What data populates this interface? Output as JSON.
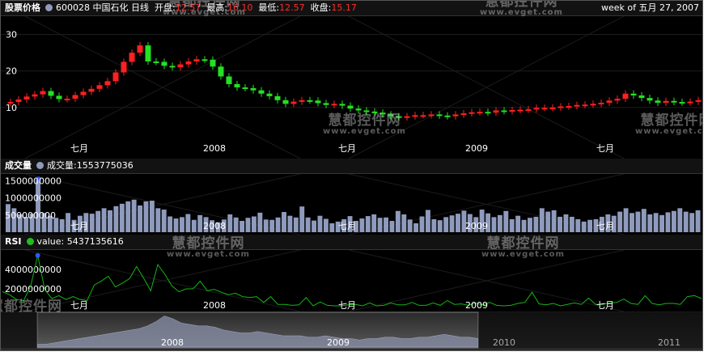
{
  "price_panel": {
    "title": "股票价格",
    "stock": "600028 中国石化 日线",
    "open_label": "开盘:",
    "open_value": "12.57",
    "high_label": "最高:",
    "high_value": "16.10",
    "low_label": "最低:",
    "low_value": "12.57",
    "close_label": "收盘:",
    "close_value": "15.17",
    "week_label": "week of 五月 27, 2007",
    "yaxis": [
      "30",
      "20",
      "10"
    ],
    "xaxis": [
      "七月",
      "2008",
      "七月",
      "2009",
      "七月"
    ]
  },
  "volume_panel": {
    "title": "成交量",
    "value_text": "成交量:1553775036",
    "yaxis": [
      "1500000000",
      "1000000000",
      "500000000"
    ],
    "xaxis": [
      "七月",
      "2008",
      "七月",
      "2009",
      "七月"
    ]
  },
  "rsi_panel": {
    "title": "RSI",
    "value_text": "value: 5437135616",
    "yaxis": [
      "4000000000",
      "2000000000"
    ],
    "xaxis": [
      "七月",
      "2008",
      "七月",
      "2009",
      "七月"
    ]
  },
  "navigator": {
    "labels": [
      "2008",
      "2009",
      "2010",
      "2011"
    ]
  },
  "watermark": {
    "text": "慧都控件网",
    "url": "www.evget.com"
  },
  "colors": {
    "up": "#ff2020",
    "down": "#25e025",
    "volume_bar": "#8f9bbd",
    "rsi_line": "#16b316",
    "marker": "#3355ff",
    "price_dot": "#8f9bbd",
    "rsi_dot": "#22bb22"
  },
  "chart_data": [
    {
      "type": "candlestick",
      "title": "股票价格",
      "series_name": "600028 中国石化 日线",
      "ylim": [
        0,
        35
      ],
      "x_ticks": [
        "七月",
        "2008",
        "七月",
        "2009",
        "七月"
      ],
      "weekly_close": [
        11.5,
        12.2,
        13.0,
        13.6,
        14.5,
        13.2,
        12.3,
        12.4,
        13.4,
        14.3,
        15.1,
        16.1,
        17.2,
        19.6,
        22.5,
        25.0,
        27.0,
        22.6,
        22.5,
        21.4,
        21.0,
        21.8,
        22.6,
        23.2,
        23.1,
        21.2,
        18.5,
        16.4,
        15.5,
        15.3,
        14.7,
        13.8,
        13.1,
        12.0,
        11.0,
        11.6,
        12.0,
        11.9,
        11.2,
        10.7,
        11.0,
        10.5,
        9.7,
        9.2,
        8.9,
        8.6,
        8.1,
        7.6,
        7.3,
        7.6,
        7.9,
        7.9,
        8.1,
        7.8,
        7.6,
        8.1,
        8.4,
        8.7,
        8.8,
        8.6,
        9.2,
        9.0,
        9.3,
        9.4,
        9.5,
        9.9,
        9.9,
        10.0,
        10.3,
        10.4,
        10.7,
        10.8,
        11.0,
        11.3,
        11.9,
        12.4,
        13.8,
        13.3,
        12.6,
        11.9,
        11.3,
        11.8,
        11.5,
        11.4,
        11.6,
        12.0
      ]
    },
    {
      "type": "bar",
      "title": "成交量",
      "ylim": [
        0,
        1700000000
      ],
      "x_ticks": [
        "七月",
        "2008",
        "七月",
        "2009",
        "七月"
      ],
      "values": [
        820,
        700,
        520,
        450,
        540,
        1553,
        560,
        480,
        420,
        380,
        560,
        360,
        480,
        560,
        540,
        620,
        700,
        640,
        760,
        830,
        900,
        950,
        780,
        900,
        920,
        700,
        660,
        460,
        400,
        440,
        530,
        360,
        500,
        440,
        350,
        290,
        370,
        520,
        430,
        330,
        420,
        460,
        570,
        370,
        360,
        430,
        590,
        480,
        430,
        750,
        430,
        340,
        480,
        390,
        260,
        310,
        380,
        470,
        330,
        400,
        470,
        520,
        420,
        430,
        330,
        620,
        520,
        370,
        260,
        460,
        650,
        380,
        350,
        440,
        490,
        540,
        630,
        530,
        440,
        660,
        550,
        440,
        500,
        620,
        380,
        480,
        360,
        420,
        450,
        700,
        600,
        640,
        450,
        520,
        450,
        380,
        310,
        360,
        380,
        450,
        520,
        480,
        600,
        700,
        560,
        600,
        680,
        520,
        560,
        500,
        580,
        620,
        700,
        600,
        560,
        640
      ]
    },
    {
      "type": "line",
      "title": "RSI",
      "series_name": "value",
      "ylim": [
        0,
        6000000000
      ],
      "x_ticks": [
        "七月",
        "2008",
        "七月",
        "2009",
        "七月"
      ],
      "values": [
        1720,
        1400,
        900,
        780,
        2280,
        5437,
        1900,
        1000,
        1300,
        900,
        1200,
        900,
        800,
        2400,
        2800,
        3300,
        2200,
        2600,
        3050,
        4300,
        3100,
        1800,
        4500,
        3500,
        2300,
        1700,
        2000,
        2000,
        2800,
        1800,
        1950,
        1650,
        1400,
        1550,
        1200,
        1100,
        1200,
        600,
        1200,
        400,
        400,
        300,
        350,
        1100,
        250,
        650,
        300,
        250,
        250,
        350,
        400,
        250,
        550,
        250,
        300,
        550,
        350,
        350,
        600,
        300,
        300,
        550,
        300,
        800,
        400,
        450,
        300,
        550,
        350,
        600,
        300,
        250,
        300,
        500,
        600,
        1650,
        450,
        350,
        500,
        250,
        400,
        550,
        400,
        1050,
        400,
        400,
        550,
        600,
        950,
        500,
        400,
        1300,
        500,
        350,
        500,
        500,
        400,
        1200,
        1300,
        1000
      ]
    },
    {
      "type": "area",
      "title": "",
      "x_ticks": [
        "2008",
        "2009",
        "2010",
        "2011"
      ],
      "values": [
        2,
        2,
        3,
        4,
        5,
        6,
        7,
        8,
        9,
        10,
        11,
        12,
        13,
        15,
        18,
        22,
        20,
        17,
        16,
        15,
        15,
        14,
        12,
        11,
        10,
        10,
        11,
        10,
        9,
        8,
        8,
        8,
        7,
        7,
        8,
        7,
        6,
        6,
        5,
        6,
        6,
        7,
        7,
        6,
        6,
        7,
        7,
        8,
        9,
        8,
        7,
        7,
        6
      ]
    }
  ]
}
